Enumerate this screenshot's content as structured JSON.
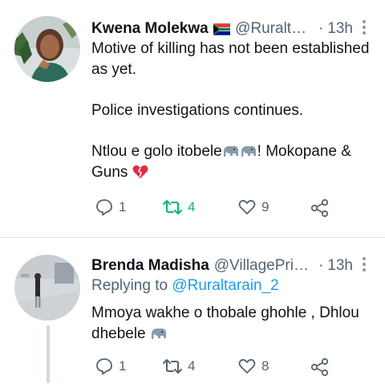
{
  "tweets": [
    {
      "author_name": "Kwena Molekwa",
      "flag_icon": "south-africa-flag-icon",
      "handle": "@Ruraltar...",
      "dot": "·",
      "time": "13h",
      "paragraphs": [
        "Motive of killing has not been established as yet.",
        "Police investigations continues."
      ],
      "last_paragraph_start": "Ntlou e golo itobele",
      "last_paragraph_mid": "! Mokopane & Guns",
      "reply_count": "1",
      "retweet_count": "4",
      "like_count": "9",
      "retweet_active": true,
      "colors": {
        "retweet_active": "#00ba7c"
      }
    },
    {
      "author_name": "Brenda Madisha",
      "handle": "@VillagePrie...",
      "dot": "·",
      "time": "13h",
      "replying_prefix": "Replying to ",
      "replying_to": "@Ruraltarain_2",
      "text_start": "Mmoya wakhe o thobale ghohle , Dhlou dhebele",
      "reply_count": "1",
      "retweet_count": "4",
      "like_count": "8",
      "colors": {
        "mention": "#1d9bf0"
      }
    }
  ]
}
